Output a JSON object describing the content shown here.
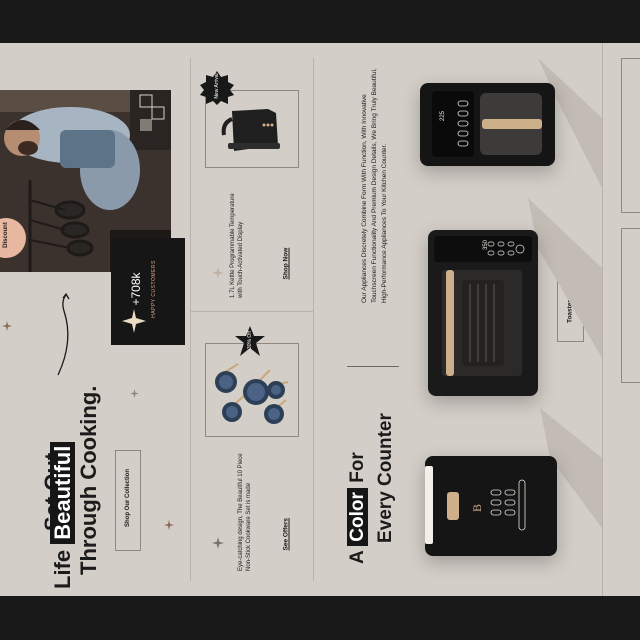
{
  "hero": {
    "line1": "Set Out",
    "line2_pre": "Life",
    "line2_highlight": "Beautiful",
    "line3": "Through Cooking.",
    "cta": "Shop Our Collection",
    "discount_badge": "Discount",
    "stat_value": "+708k",
    "stat_label": "HAPPY CUSTOMERS"
  },
  "kettle_card": {
    "badge": "New Arrival",
    "description": "1.7L Kettle Programmable Temperature with Touch-Activated Display",
    "link": "Shop Now"
  },
  "cookware_card": {
    "badge": "30% Off",
    "description": "Eye-catching design, The Beautiful 10 Piece Non-Stick Cookware Set is made",
    "link": "See Offers"
  },
  "feature": {
    "title_pre": "A",
    "title_highlight": "Color",
    "title_post": "For",
    "title_line2": "Every Counter",
    "body": "Our Appliances Discretely Combine Form With Function, With Innovative Touchscreen Functionality And Premium Design Details, We Bring Truly Beautiful, High-Performance Appliances To Your Kitchen Counter.",
    "product_label": "Toaster Oven",
    "oven_display": "350",
    "coffee_display": "225"
  },
  "icons": [
    "sparkle-icon",
    "arrow-curve-icon",
    "star-badge-icon"
  ]
}
